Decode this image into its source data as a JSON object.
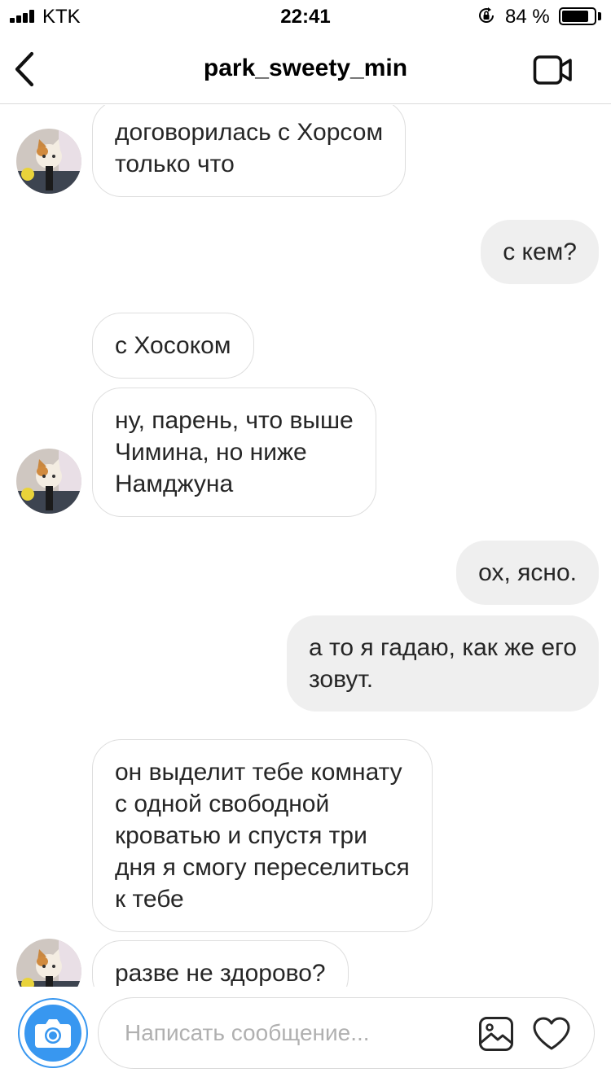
{
  "status_bar": {
    "carrier": "KTK",
    "time": "22:41",
    "battery_percent": "84 %",
    "battery_level": 0.84,
    "icons": [
      "signal-bars-icon",
      "orientation-lock-icon",
      "battery-icon"
    ]
  },
  "header": {
    "username": "park_sweety_min",
    "icons": [
      "back-chevron-icon",
      "video-call-icon"
    ]
  },
  "messages": [
    {
      "side": "in",
      "text_lines": [
        "договорилась с Хорсом",
        "только что"
      ]
    },
    {
      "side": "out",
      "text_lines": [
        "с кем?"
      ]
    },
    {
      "side": "in",
      "text_lines": [
        "с Хосоком"
      ]
    },
    {
      "side": "in",
      "text_lines": [
        "ну, парень, что выше",
        "Чимина, но ниже",
        "Намджуна"
      ]
    },
    {
      "side": "out",
      "text_lines": [
        "ох, ясно."
      ]
    },
    {
      "side": "out",
      "text_lines": [
        "а то я гадаю, как же его",
        "зовут."
      ]
    },
    {
      "side": "in",
      "text_lines": [
        "он выделит тебе комнату",
        "с одной свободной",
        "кроватью и спустя три",
        "дня я смогу переселиться",
        "к тебе"
      ]
    },
    {
      "side": "in",
      "text_lines": [
        "разве не здорово?"
      ]
    }
  ],
  "composer": {
    "placeholder": "Написать сообщение...",
    "value": "",
    "icons": [
      "camera-icon",
      "gallery-icon",
      "heart-icon"
    ]
  },
  "colors": {
    "accent_blue": "#3897f0",
    "outgoing_bubble": "#efefef",
    "incoming_border": "#dedede",
    "text": "#262626"
  }
}
